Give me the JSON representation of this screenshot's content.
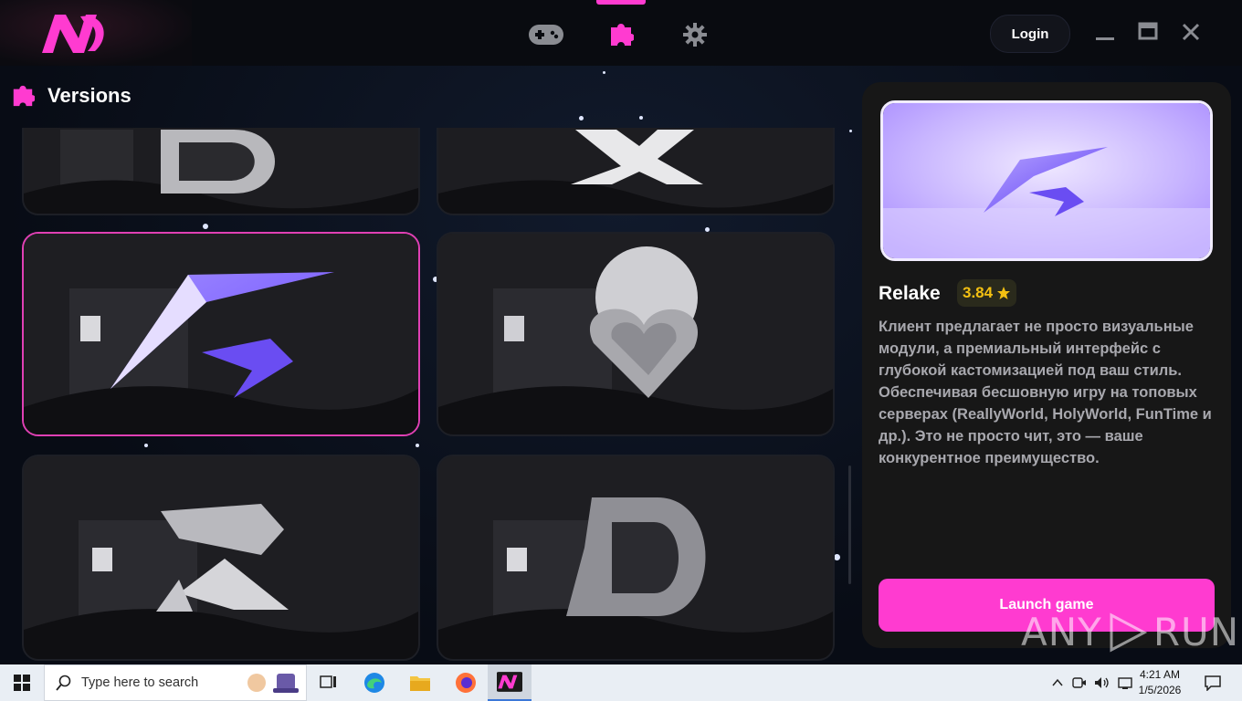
{
  "app": {
    "logo_text": "N",
    "nav": [
      {
        "name": "games",
        "icon": "gamepad-icon"
      },
      {
        "name": "versions",
        "icon": "puzzle-icon",
        "active": true
      },
      {
        "name": "settings",
        "icon": "gear-icon"
      }
    ],
    "login_label": "Login",
    "window_controls": [
      "minimize-icon",
      "maximize-icon",
      "close-icon"
    ]
  },
  "versions": {
    "title": "Versions",
    "icon": "puzzle-icon",
    "cards": [
      {
        "logo": "D-logo",
        "selected": false
      },
      {
        "logo": "X-logo",
        "selected": false
      },
      {
        "logo": "relake-lightning-logo",
        "selected": true
      },
      {
        "logo": "heart-logo",
        "selected": false
      },
      {
        "logo": "crystal-R-logo",
        "selected": false
      },
      {
        "logo": "chrome-D-logo",
        "selected": false
      }
    ]
  },
  "details": {
    "name": "Relake",
    "rating": "3.84",
    "rating_icon": "star-icon",
    "description": "Клиент предлагает не просто визуальные модули, а премиальный интерфейс с глубокой кастомизацией под ваш стиль. Обеспечивая бесшовную игру на топовых серверах (ReallyWorld, HolyWorld, FunTime и др.). Это не просто чит, это — ваше конкурентное преимущество.",
    "launch_label": "Launch game"
  },
  "watermark": {
    "text_left": "ANY",
    "text_right": "RUN"
  },
  "taskbar": {
    "search_placeholder": "Type here to search",
    "time": "4:21 AM",
    "date": "1/5/2026"
  },
  "colors": {
    "accent": "#ff3bd0",
    "rating": "#f3c012",
    "selected_border": "#e040b4"
  }
}
